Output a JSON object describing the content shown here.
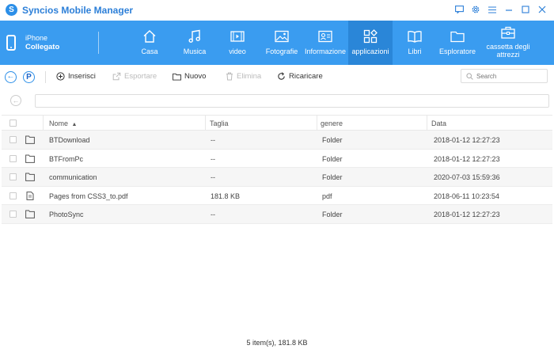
{
  "app": {
    "title": "Syncios Mobile Manager",
    "logo_letter": "S"
  },
  "device": {
    "name": "iPhone",
    "status": "Collegato"
  },
  "nav": [
    {
      "label": "Casa"
    },
    {
      "label": "Musica"
    },
    {
      "label": "video"
    },
    {
      "label": "Fotografie"
    },
    {
      "label": "Informazione"
    },
    {
      "label": "applicazioni",
      "active": true
    },
    {
      "label": "Libri"
    },
    {
      "label": "Esploratore"
    },
    {
      "label": "cassetta degli attrezzi"
    }
  ],
  "toolbar": {
    "p_letter": "P",
    "insert": "Inserisci",
    "export": "Esportare",
    "new": "Nuovo",
    "delete": "Elimina",
    "reload": "Ricaricare",
    "search_placeholder": "Search"
  },
  "table": {
    "headers": {
      "name": "Nome",
      "size": "Taglia",
      "kind": "genere",
      "date": "Data"
    },
    "rows": [
      {
        "name": "BTDownload",
        "size": "--",
        "kind": "Folder",
        "date": "2018-01-12 12:27:23",
        "icon": "folder-icon"
      },
      {
        "name": "BTFromPc",
        "size": "--",
        "kind": "Folder",
        "date": "2018-01-12 12:27:23",
        "icon": "folder-icon"
      },
      {
        "name": "communication",
        "size": "--",
        "kind": "Folder",
        "date": "2020-07-03 15:59:36",
        "icon": "folder-icon"
      },
      {
        "name": "Pages from CSS3_to.pdf",
        "size": "181.8 KB",
        "kind": "pdf",
        "date": "2018-06-11 10:23:54",
        "icon": "file-icon"
      },
      {
        "name": "PhotoSync",
        "size": "--",
        "kind": "Folder",
        "date": "2018-01-12 12:27:23",
        "icon": "folder-icon"
      }
    ]
  },
  "footer": {
    "summary": "5 item(s), 181.8 KB"
  },
  "colors": {
    "accent": "#3a9cf0",
    "active_tab": "#2a86d8",
    "title": "#2c7fd8"
  }
}
